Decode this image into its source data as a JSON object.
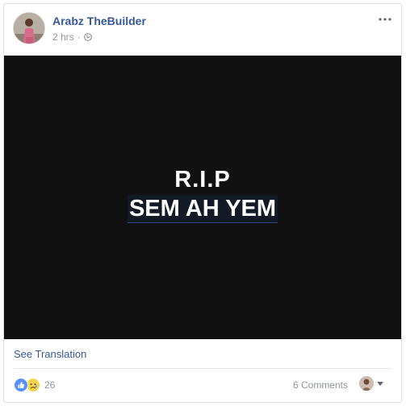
{
  "post": {
    "author_name": "Arabz TheBuilder",
    "timestamp": "2 hrs",
    "separator": "·",
    "privacy_icon": "globe-icon",
    "more_icon": "ellipsis-icon"
  },
  "image": {
    "line1": "R.I.P",
    "line2": "SEM AH YEM",
    "background": "#111111"
  },
  "actions": {
    "see_translation": "See Translation"
  },
  "footer": {
    "reaction_icons": [
      "like-icon",
      "sad-icon"
    ],
    "reaction_count": "26",
    "comments_label": "6 Comments",
    "viewer_icon": "avatar-icon",
    "caret_icon": "caret-down-icon"
  },
  "colors": {
    "link_blue": "#365899",
    "meta_gray": "#90949c",
    "like_blue": "#5890ff",
    "sad_yellow": "#f7d44c"
  }
}
